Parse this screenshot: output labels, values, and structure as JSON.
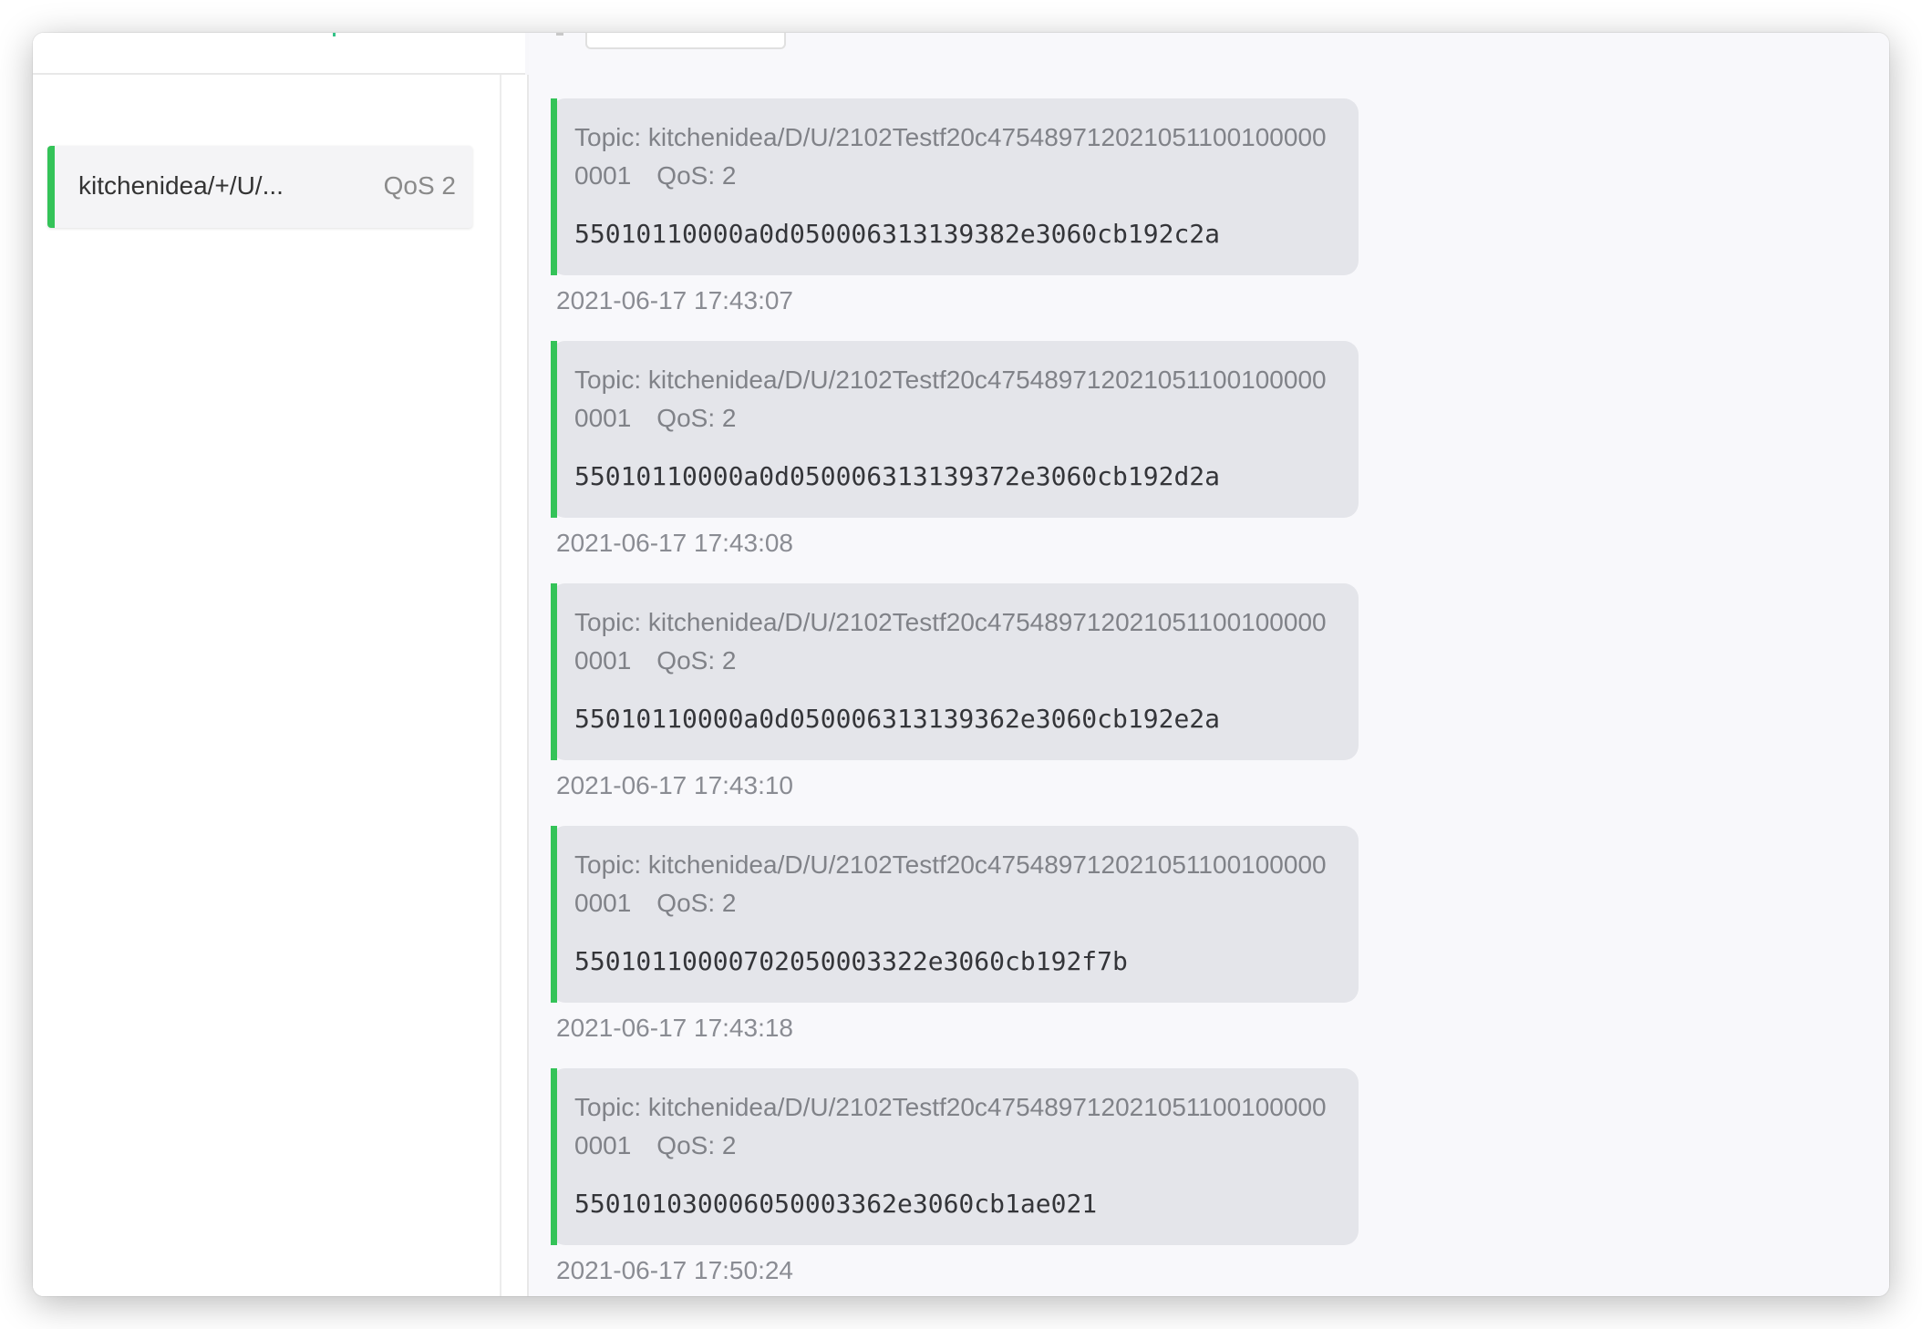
{
  "subscriptions": [
    {
      "topic": "kitchenidea/+/U/...",
      "qos": "QoS 2",
      "color": "#34c358"
    }
  ],
  "messages": [
    {
      "topic_line1": "Topic: kitchenidea/D/U/2102Testf20c475489712021051100100",
      "topic_line2": "0000001",
      "qos": "QoS: 2",
      "payload": "55010110000a0d050006313139382e3060cb192c2a",
      "time": "2021-06-17 17:43:07"
    },
    {
      "topic_line1": "Topic: kitchenidea/D/U/2102Testf20c475489712021051100100",
      "topic_line2": "0000001",
      "qos": "QoS: 2",
      "payload": "55010110000a0d050006313139372e3060cb192d2a",
      "time": "2021-06-17 17:43:08"
    },
    {
      "topic_line1": "Topic: kitchenidea/D/U/2102Testf20c475489712021051100100",
      "topic_line2": "0000001",
      "qos": "QoS: 2",
      "payload": "55010110000a0d050006313139362e3060cb192e2a",
      "time": "2021-06-17 17:43:10"
    },
    {
      "topic_line1": "Topic: kitchenidea/D/U/2102Testf20c475489712021051100100",
      "topic_line2": "0000001",
      "qos": "QoS: 2",
      "payload": "55010110000702050003322e3060cb192f7b",
      "time": "2021-06-17 17:43:18"
    },
    {
      "topic_line1": "Topic: kitchenidea/D/U/2102Testf20c475489712021051100100",
      "topic_line2": "0000001",
      "qos": "QoS: 2",
      "payload": "55010103000605000336 2e3060cb1ae021",
      "time": "2021-06-17 17:50:24"
    }
  ],
  "colors": {
    "accent": "#34c358",
    "bubble": "#e4e5ea"
  }
}
